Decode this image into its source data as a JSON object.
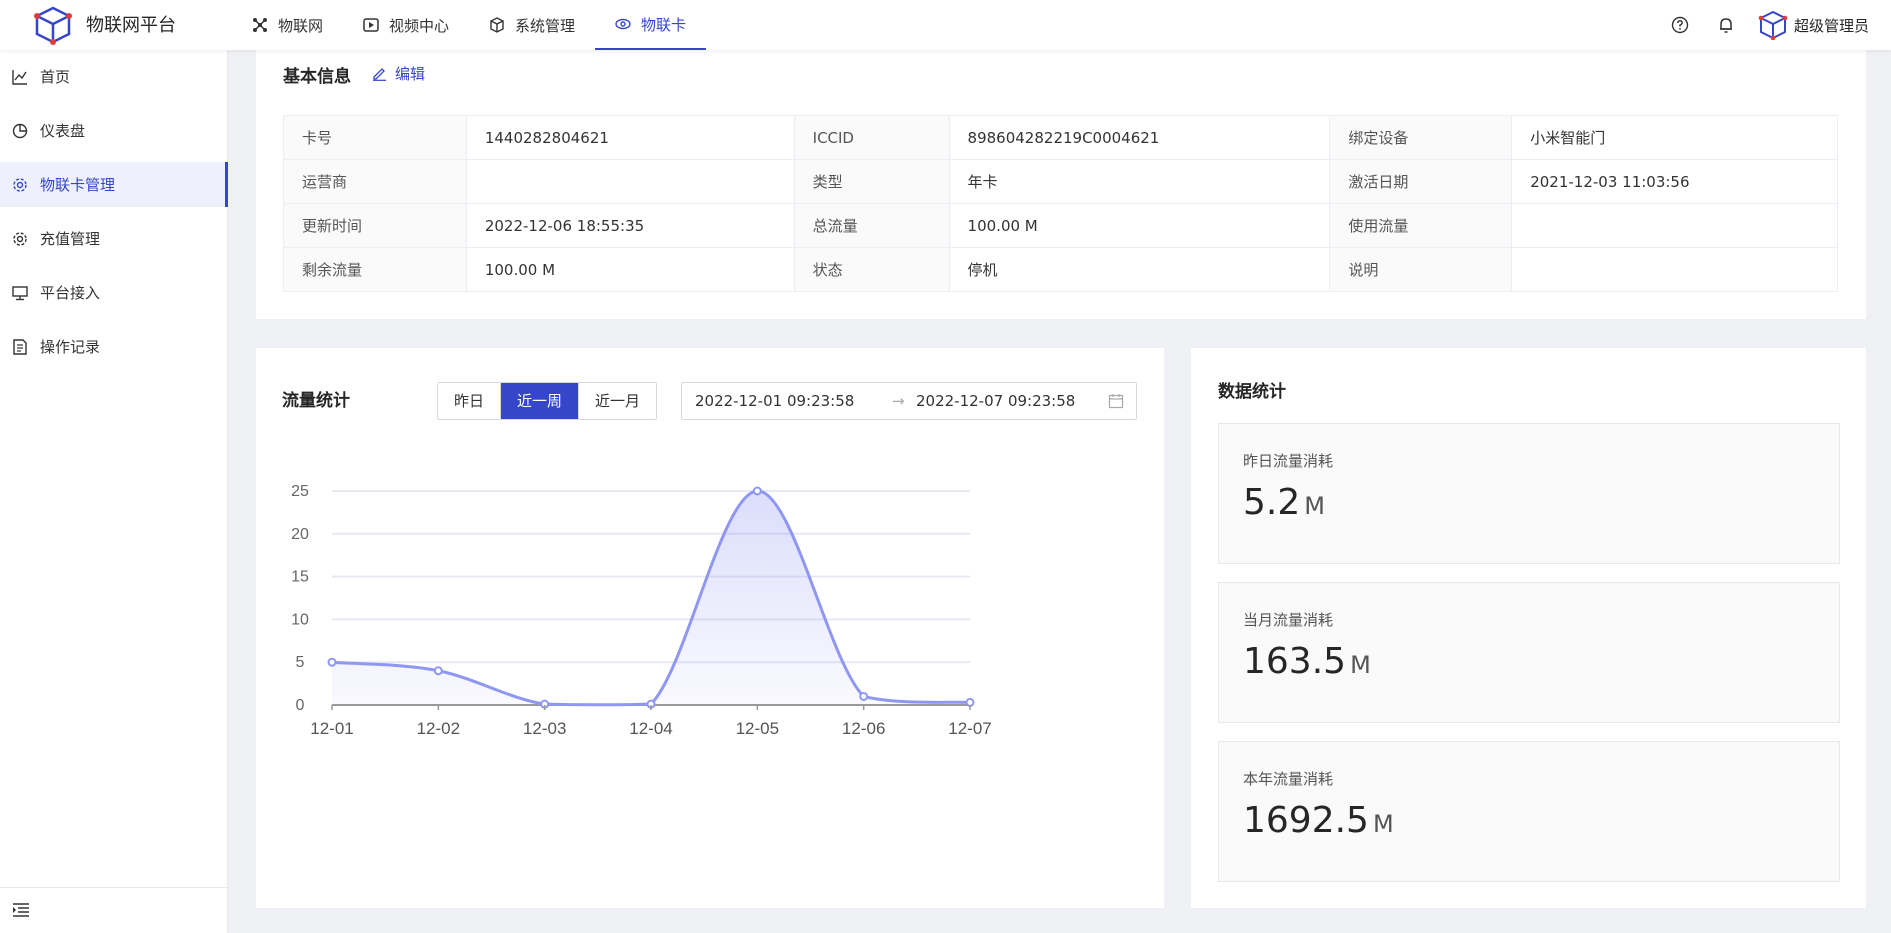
{
  "brand": {
    "name": "物联网平台"
  },
  "topnav": [
    {
      "label": "物联网",
      "icon": "grid-icon",
      "active": false
    },
    {
      "label": "视频中心",
      "icon": "play-icon",
      "active": false
    },
    {
      "label": "系统管理",
      "icon": "cube-icon",
      "active": false
    },
    {
      "label": "物联卡",
      "icon": "eye-icon",
      "active": true
    }
  ],
  "header": {
    "user_name": "超级管理员",
    "icons": [
      "help-icon",
      "bell-icon"
    ]
  },
  "sidebar": {
    "items": [
      {
        "label": "首页",
        "icon": "chart-icon"
      },
      {
        "label": "仪表盘",
        "icon": "pie-icon"
      },
      {
        "label": "物联卡管理",
        "icon": "gear-icon",
        "active": true
      },
      {
        "label": "充值管理",
        "icon": "gear-icon"
      },
      {
        "label": "平台接入",
        "icon": "monitor-icon"
      },
      {
        "label": "操作记录",
        "icon": "document-icon"
      }
    ]
  },
  "info": {
    "title": "基本信息",
    "edit_label": "编辑",
    "rows": [
      [
        {
          "label": "卡号",
          "value": "1440282804621"
        },
        {
          "label": "ICCID",
          "value": "898604282219C0004621"
        },
        {
          "label": "绑定设备",
          "value": "小米智能门"
        }
      ],
      [
        {
          "label": "运营商",
          "value": ""
        },
        {
          "label": "类型",
          "value": "年卡"
        },
        {
          "label": "激活日期",
          "value": "2021-12-03 11:03:56"
        }
      ],
      [
        {
          "label": "更新时间",
          "value": "2022-12-06 18:55:35"
        },
        {
          "label": "总流量",
          "value": "100.00 M"
        },
        {
          "label": "使用流量",
          "value": ""
        }
      ],
      [
        {
          "label": "剩余流量",
          "value": "100.00 M"
        },
        {
          "label": "状态",
          "value": "停机"
        },
        {
          "label": "说明",
          "value": ""
        }
      ]
    ]
  },
  "traffic": {
    "title": "流量统计",
    "ranges": [
      {
        "label": "昨日",
        "active": false
      },
      {
        "label": "近一周",
        "active": true
      },
      {
        "label": "近一月",
        "active": false
      }
    ],
    "date_start": "2022-12-01 09:23:58",
    "date_end": "2022-12-07 09:23:58",
    "arrow": "→"
  },
  "chart_data": {
    "type": "area",
    "categories": [
      "12-01",
      "12-02",
      "12-03",
      "12-04",
      "12-05",
      "12-06",
      "12-07"
    ],
    "values": [
      5,
      4,
      0.1,
      0.1,
      25,
      1,
      0.3
    ],
    "yticks": [
      0,
      5,
      10,
      15,
      20,
      25
    ],
    "ylim": [
      0,
      25
    ],
    "color": "#8f97f2",
    "grid": true,
    "smooth": true
  },
  "stats": {
    "title": "数据统计",
    "boxes": [
      {
        "label": "昨日流量消耗",
        "value": "5.2",
        "unit": "M"
      },
      {
        "label": "当月流量消耗",
        "value": "163.5",
        "unit": "M"
      },
      {
        "label": "本年流量消耗",
        "value": "1692.5",
        "unit": "M"
      }
    ]
  }
}
